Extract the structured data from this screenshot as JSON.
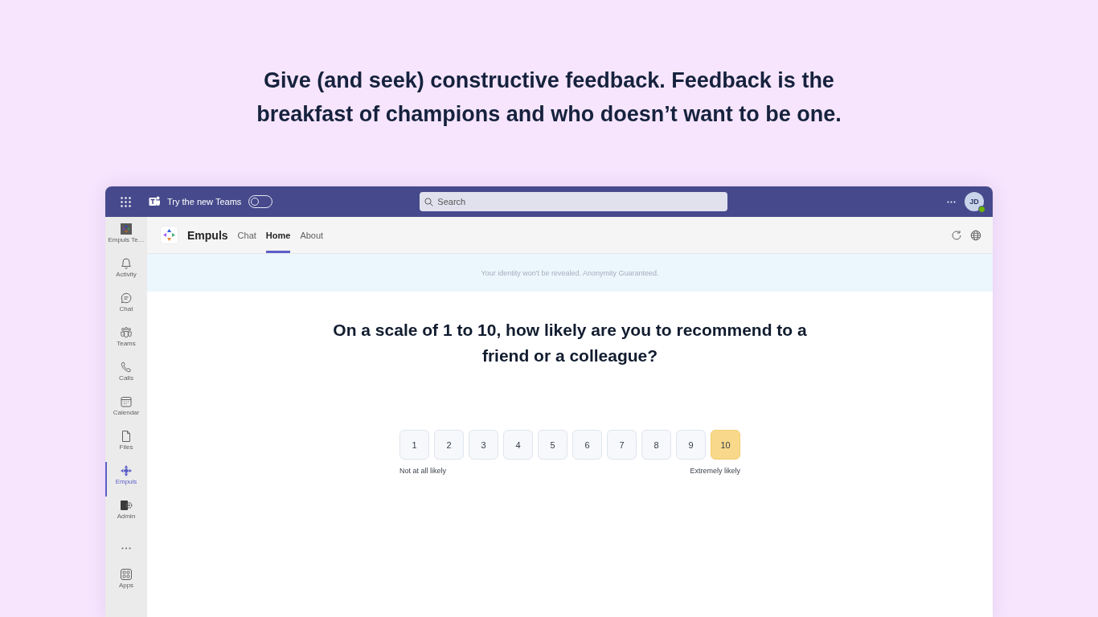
{
  "headline": "Give (and seek) constructive feedback. Feedback is the breakfast of champions and who doesn’t want to be one.",
  "title_bar": {
    "toggle": {
      "label": "Try the new Teams",
      "on": false
    },
    "search": {
      "placeholder": "Search"
    },
    "avatar": {
      "initials": "JD",
      "online": true
    }
  },
  "rail": {
    "items": [
      {
        "label": "Empuls Te…",
        "selected": false
      },
      {
        "label": "Activity",
        "selected": false
      },
      {
        "label": "Chat",
        "selected": false
      },
      {
        "label": "Teams",
        "selected": false
      },
      {
        "label": "Calls",
        "selected": false
      },
      {
        "label": "Calendar",
        "selected": false
      },
      {
        "label": "Files",
        "selected": false
      },
      {
        "label": "Empuls",
        "selected": true
      },
      {
        "label": "Admin",
        "selected": false
      }
    ],
    "apps": {
      "label": "Apps",
      "selected": false
    }
  },
  "app_header": {
    "name": "Empuls",
    "tabs": [
      {
        "label": "Chat",
        "selected": false
      },
      {
        "label": "Home",
        "selected": true
      },
      {
        "label": "About",
        "selected": false
      }
    ]
  },
  "banner": "Your identity won't be revealed. Anonymity Guaranteed.",
  "question": "On a scale of 1 to 10, how likely are you to recommend to a friend or a colleague?",
  "scale": {
    "options": [
      {
        "label": "1",
        "selected": false
      },
      {
        "label": "2",
        "selected": false
      },
      {
        "label": "3",
        "selected": false
      },
      {
        "label": "4",
        "selected": false
      },
      {
        "label": "5",
        "selected": false
      },
      {
        "label": "6",
        "selected": false
      },
      {
        "label": "7",
        "selected": false
      },
      {
        "label": "8",
        "selected": false
      },
      {
        "label": "9",
        "selected": false
      },
      {
        "label": "10",
        "selected": true
      }
    ],
    "min_label": "Not at all likely",
    "max_label": "Extremely likely"
  }
}
